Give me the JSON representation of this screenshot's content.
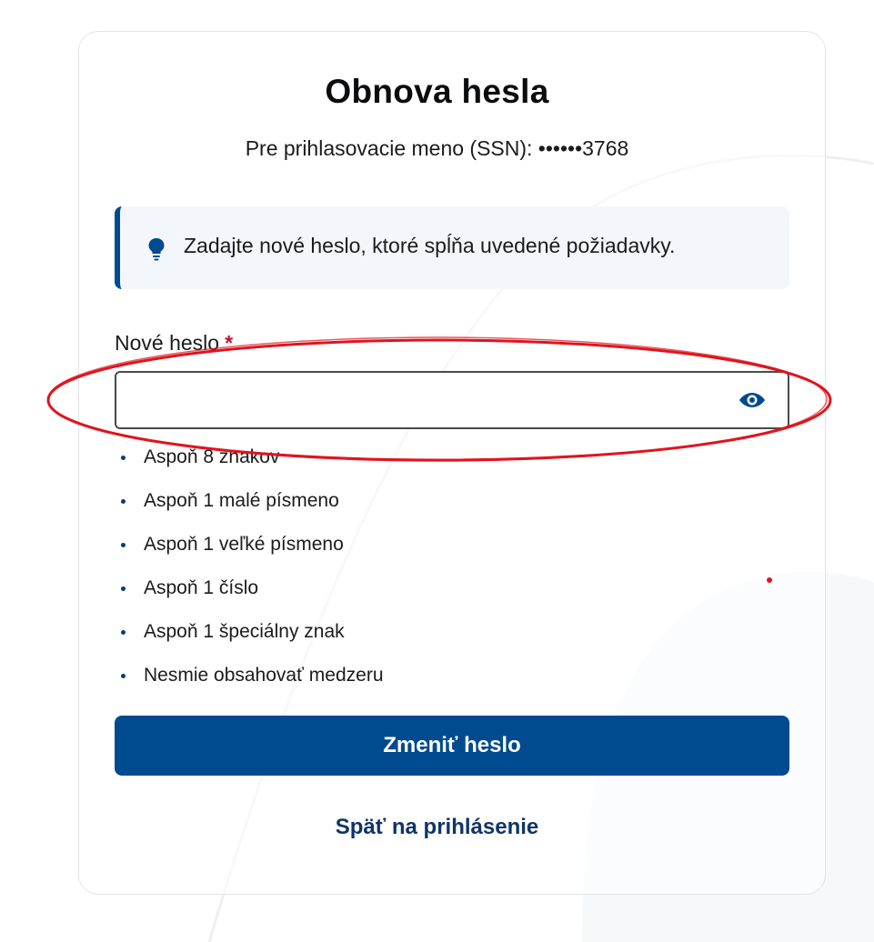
{
  "colors": {
    "primary": "#004a8f",
    "link": "#0f3568",
    "required": "#c0132c",
    "info_bg": "#f3f7fc",
    "annotation": "#e0141e"
  },
  "header": {
    "title": "Obnova hesla",
    "subtitle": "Pre prihlasovacie meno (SSN): ••••••3768"
  },
  "info": {
    "icon": "lightbulb-icon",
    "text": "Zadajte nové heslo, ktoré spĺňa uvedené požiadavky."
  },
  "password_field": {
    "label": "Nové heslo",
    "required_mark": "*",
    "value": "",
    "toggle_icon": "eye-icon"
  },
  "requirements": [
    "Aspoň 8 znakov",
    "Aspoň 1 malé písmeno",
    "Aspoň 1 veľké písmeno",
    "Aspoň 1 číslo",
    "Aspoň 1 špeciálny znak",
    "Nesmie obsahovať medzeru"
  ],
  "actions": {
    "submit_label": "Zmeniť heslo",
    "back_label": "Späť na prihlásenie"
  }
}
